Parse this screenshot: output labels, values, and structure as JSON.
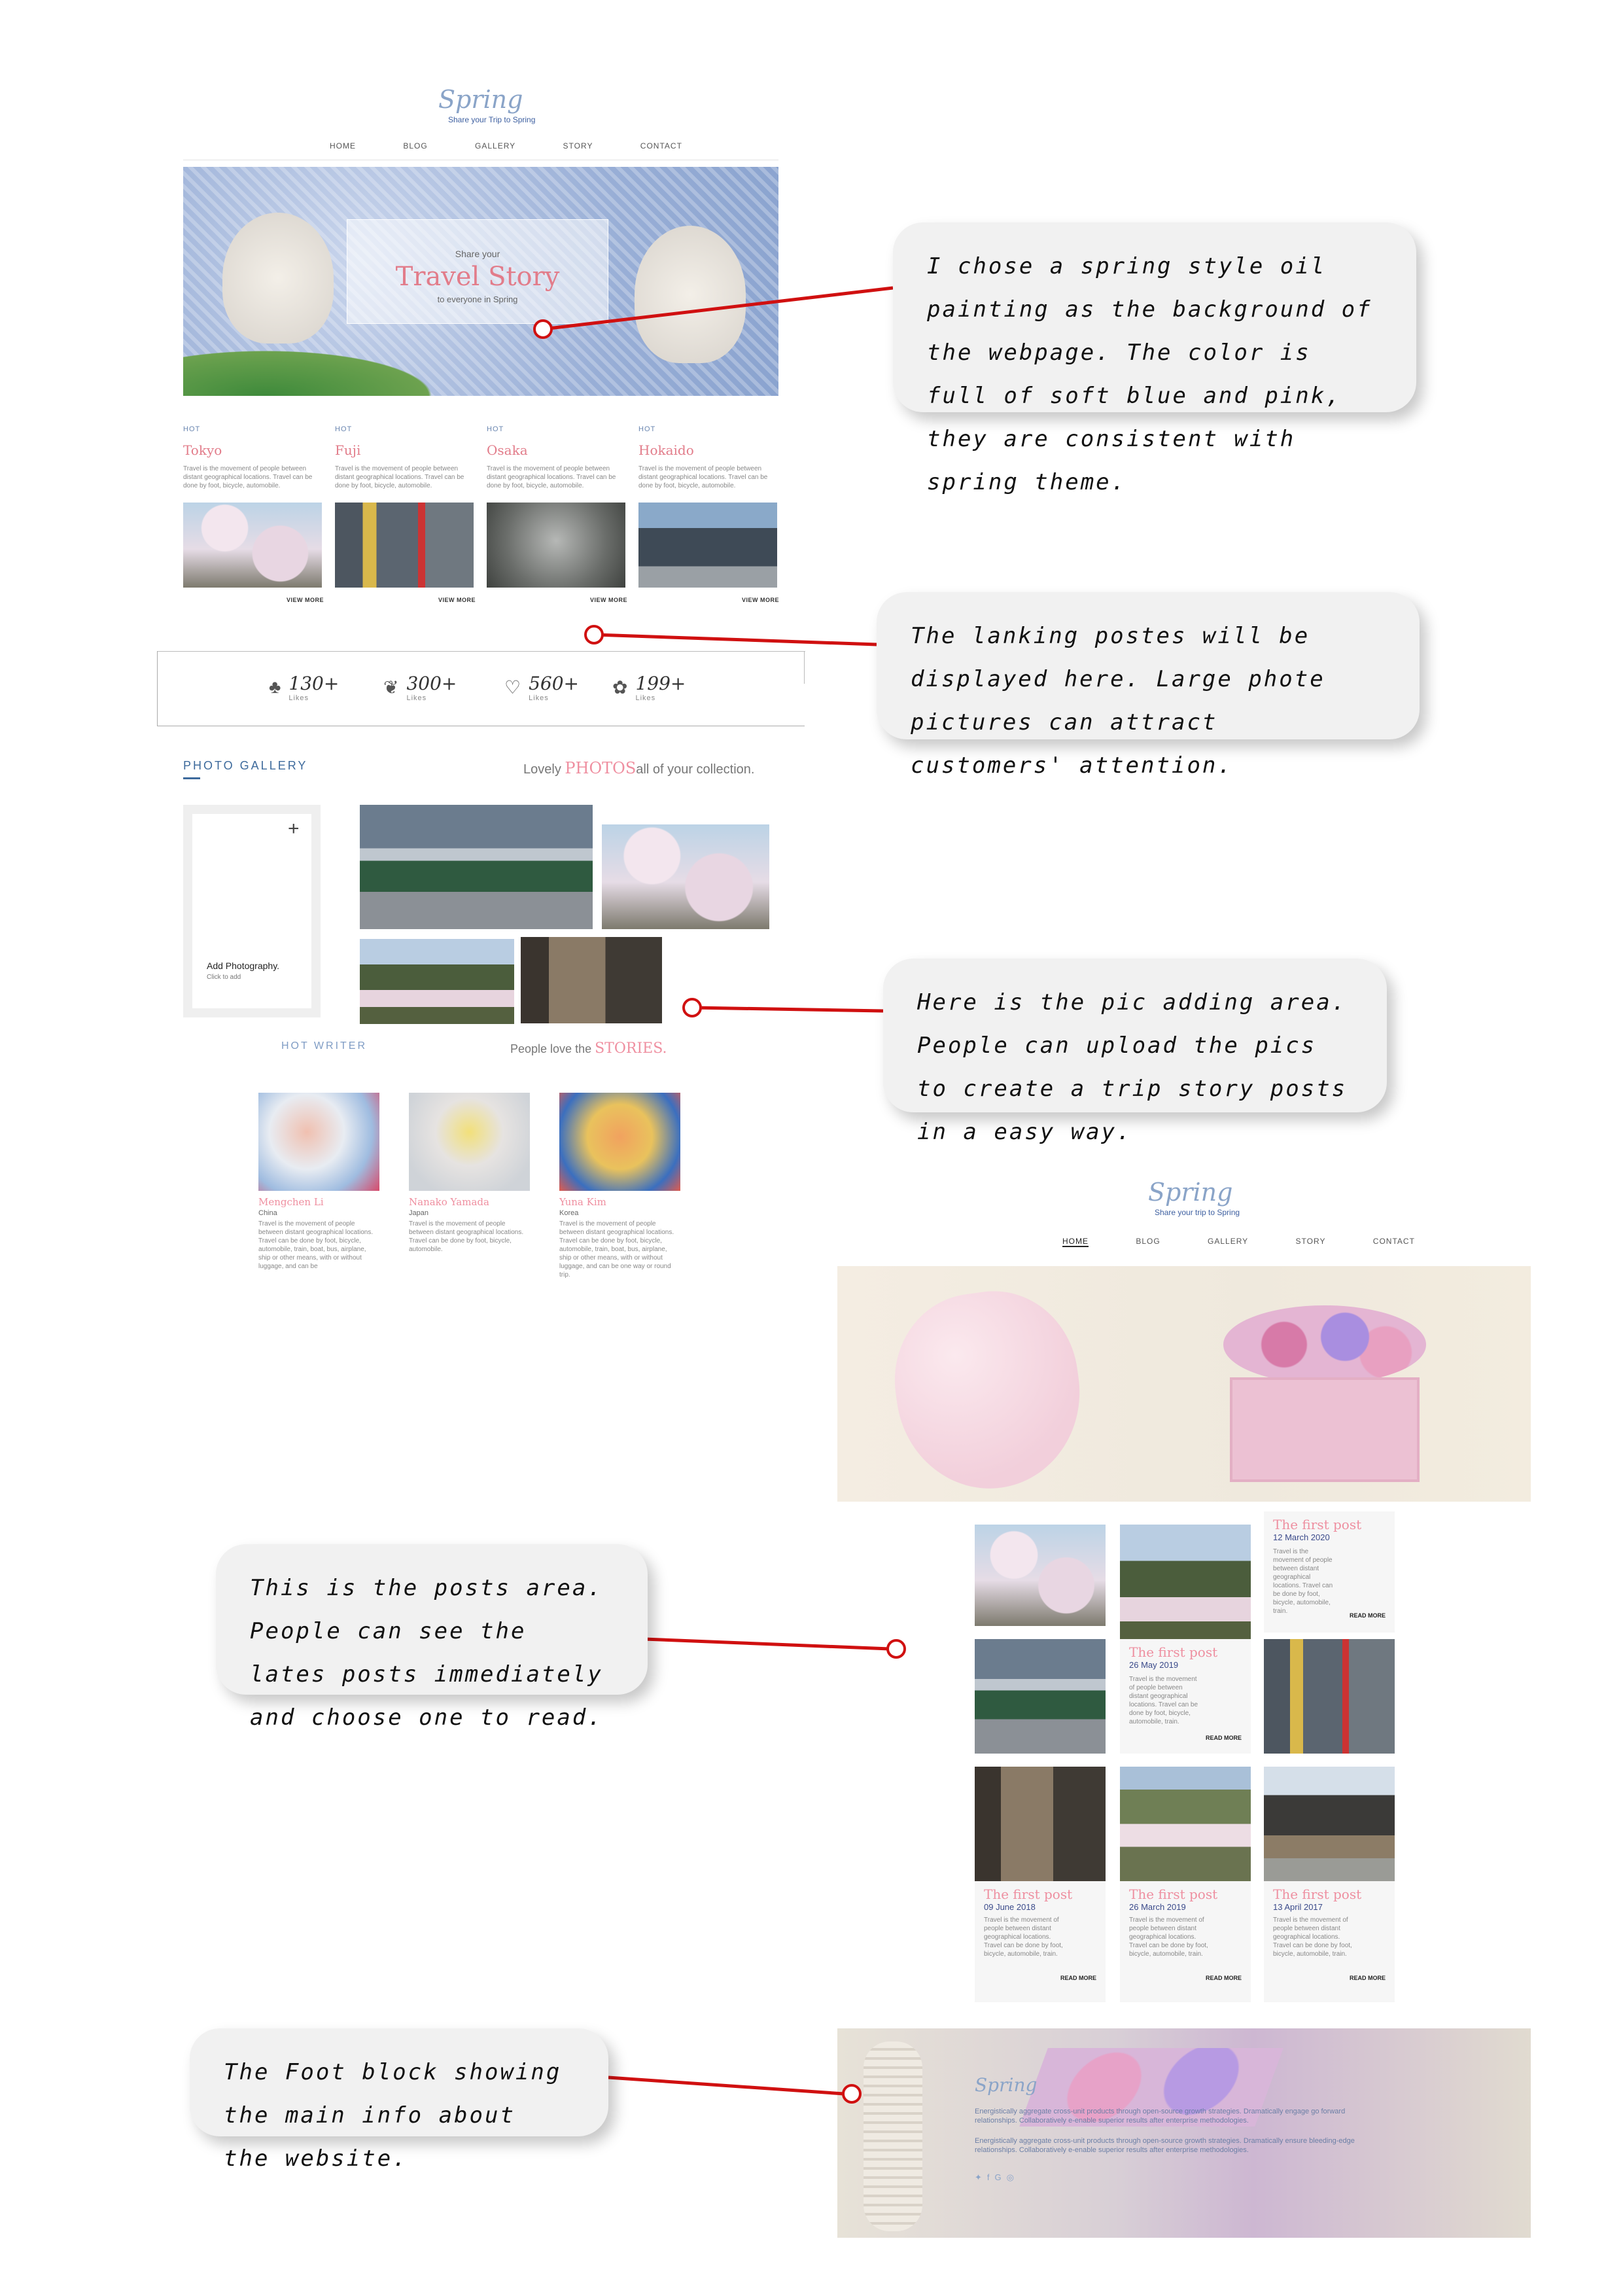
{
  "site": {
    "logo": "Spring",
    "tagline": "Share your Trip to Spring",
    "tagline2": "Share your trip to Spring"
  },
  "nav": [
    "HOME",
    "BLOG",
    "GALLERY",
    "STORY",
    "CONTACT"
  ],
  "hero": {
    "pre": "Share your",
    "title": "Travel Story",
    "post": "to everyone in Spring"
  },
  "hot_cards": [
    {
      "tag": "HOT",
      "title": "Tokyo",
      "desc": "Travel is the movement of people between distant geographical locations. Travel can be done by foot, bicycle, automobile.",
      "link": "VIEW MORE"
    },
    {
      "tag": "HOT",
      "title": "Fuji",
      "desc": "Travel is the movement of people between distant geographical locations. Travel can be done by foot, bicycle, automobile.",
      "link": "VIEW MORE"
    },
    {
      "tag": "HOT",
      "title": "Osaka",
      "desc": "Travel is the movement of people between distant geographical locations. Travel can be done by foot, bicycle, automobile.",
      "link": "VIEW MORE"
    },
    {
      "tag": "HOT",
      "title": "Hokaido",
      "desc": "Travel is the movement of people between distant geographical locations. Travel can be done by foot, bicycle, automobile.",
      "link": "VIEW MORE"
    }
  ],
  "likes": [
    {
      "num": "130+",
      "label": "Likes"
    },
    {
      "num": "300+",
      "label": "Likes"
    },
    {
      "num": "560+",
      "label": "Likes"
    },
    {
      "num": "199+",
      "label": "Likes"
    }
  ],
  "gallery": {
    "heading": "PHOTO GALLERY",
    "lead": "Lovely",
    "highlight": "PHOTOS",
    "tail": "all of your collection.",
    "add_title": "Add Photography.",
    "add_sub": "Click to add",
    "plus": "+"
  },
  "writers": {
    "heading": "HOT WRITER",
    "lead": "People love the",
    "highlight": "STORIES.",
    "items": [
      {
        "name": "Mengchen Li",
        "country": "China",
        "desc": "Travel is the movement of people between distant geographical locations. Travel can be done by foot, bicycle, automobile, train, boat, bus, airplane, ship or other means, with or without luggage, and can be"
      },
      {
        "name": "Nanako Yamada",
        "country": "Japan",
        "desc": "Travel is the movement of people between distant geographical locations. Travel can be done by foot, bicycle, automobile."
      },
      {
        "name": "Yuna Kim",
        "country": "Korea",
        "desc": "Travel is the movement of people between distant geographical locations. Travel can be done by foot, bicycle, automobile, train, boat, bus, airplane, ship or other means, with or without luggage, and can be one way or round trip."
      }
    ]
  },
  "posts": [
    {
      "title": "The first post",
      "date": "12 March 2020",
      "desc": "Travel is the movement of people between distant geographical locations. Travel can be done by foot, bicycle, automobile, train.",
      "link": "READ MORE"
    },
    {
      "title": "The first post",
      "date": "26 May 2019",
      "desc": "Travel is the movement of people between distant geographical locations. Travel can be done by foot, bicycle, automobile, train.",
      "link": "READ MORE"
    },
    {
      "title": "The first post",
      "date": "09 June 2018",
      "desc": "Travel is the movement of people between distant geographical locations. Travel can be done by foot, bicycle, automobile, train.",
      "link": "READ MORE"
    },
    {
      "title": "The first post",
      "date": "26 March 2019",
      "desc": "Travel is the movement of people between distant geographical locations. Travel can be done by foot, bicycle, automobile, train.",
      "link": "READ MORE"
    },
    {
      "title": "The first post",
      "date": "13 April 2017",
      "desc": "Travel is the movement of people between distant geographical locations. Travel can be done by foot, bicycle, automobile, train.",
      "link": "READ MORE"
    }
  ],
  "footer": {
    "logo": "Spring",
    "p1": "Energistically aggregate cross-unit products through open-source growth strategies. Dramatically engage go forward relationships. Collaboratively e-enable superior results after enterprise methodologies.",
    "p2": "Energistically aggregate cross-unit products through open-source growth strategies. Dramatically ensure bleeding-edge relationships. Collaboratively e-enable superior results after enterprise methodologies."
  },
  "notes": [
    "I chose a spring style oil painting as the background of the webpage. The color is full of soft blue and pink, they are consistent with spring theme.",
    "The lanking postes will be displayed here. Large phote pictures can attract customers' attention.",
    "Here is the pic adding area. People can upload the pics to create a trip story posts in a easy way.",
    "This is the posts area. People can see the lates posts immediately and choose one to read.",
    "The Foot block showing the main info about the website."
  ],
  "colors": {
    "accent_pink": "#e27c8a",
    "accent_blue": "#7f9cc4",
    "connector_red": "#d01010"
  }
}
